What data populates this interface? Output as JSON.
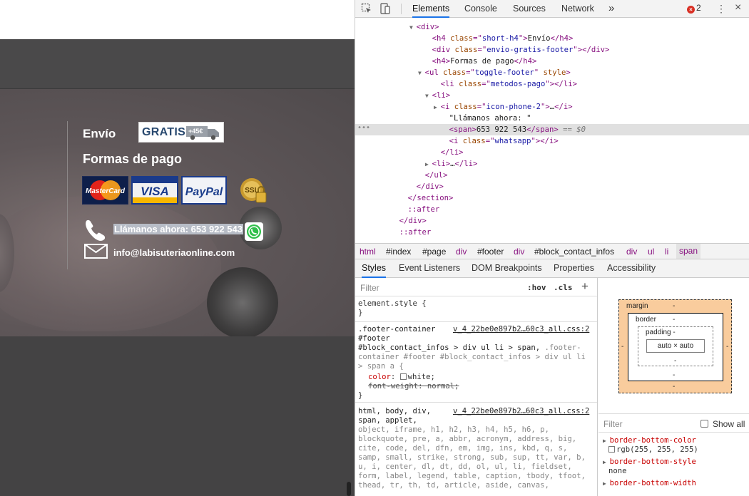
{
  "site": {
    "footer": {
      "envio_heading": "Envío",
      "gratis_badge": "GRATIS",
      "gratis_amount": "+45€",
      "formas_heading": "Formas de pago",
      "payment_methods": [
        "MasterCard",
        "VISA",
        "PayPal",
        "SSL"
      ],
      "phone_text": "Llámanos ahora: 653 922 543",
      "email": "info@labisuteriaonline.com"
    }
  },
  "devtools": {
    "tabs": [
      "Elements",
      "Console",
      "Sources",
      "Network"
    ],
    "more_tabs": "»",
    "error_count": "2",
    "error_mark": "×",
    "tree": [
      {
        "tri": "▼",
        "html": "<span class='tag'>&lt;div&gt;</span>"
      },
      {
        "tri": "",
        "html": "<span class='tag'>&lt;h4</span> <span class='an'>class</span><span class='tag'>=\"</span><span class='av'>short-h4</span><span class='tag'>\"&gt;</span><span class='tx'>Envío</span><span class='tag'>&lt;/h4&gt;</span>"
      },
      {
        "tri": "",
        "html": "<span class='tag'>&lt;div</span> <span class='an'>class</span><span class='tag'>=\"</span><span class='av'>envio-gratis-footer</span><span class='tag'>\"&gt;&lt;/div&gt;</span>"
      },
      {
        "tri": "",
        "html": "<span class='tag'>&lt;h4&gt;</span><span class='tx'>Formas de pago</span><span class='tag'>&lt;/h4&gt;</span>"
      },
      {
        "tri": "▼",
        "html": "<span class='tag'>&lt;ul</span> <span class='an'>class</span><span class='tag'>=\"</span><span class='av'>toggle-footer</span><span class='tag'>\"</span> <span class='an'>style</span><span class='tag'>&gt;</span>"
      },
      {
        "tri": "",
        "html": "<span class='tag'>&lt;li</span> <span class='an'>class</span><span class='tag'>=\"</span><span class='av'>metodos-pago</span><span class='tag'>\"&gt;&lt;/li&gt;</span>"
      },
      {
        "tri": "▼",
        "html": "<span class='tag'>&lt;li&gt;</span>"
      },
      {
        "tri": "▶",
        "html": "<span class='tag'>&lt;i</span> <span class='an'>class</span><span class='tag'>=\"</span><span class='av'>icon-phone-2</span><span class='tag'>\"&gt;</span><span class='tx'>…</span><span class='tag'>&lt;/i&gt;</span>"
      },
      {
        "tri": "",
        "html": "<span class='tx'>\"Llámanos ahora: \"</span>"
      },
      {
        "tri": "",
        "html": "<span class='tag'>&lt;span&gt;</span><span class='tx'>653 922 543</span><span class='tag'>&lt;/span&gt;</span> <span class='eq'>== $0</span>"
      },
      {
        "tri": "",
        "html": "<span class='tag'>&lt;i</span> <span class='an'>class</span><span class='tag'>=\"</span><span class='av'>whatsapp</span><span class='tag'>\"&gt;&lt;/i&gt;</span>"
      },
      {
        "tri": "",
        "html": "<span class='tag'>&lt;/li&gt;</span>"
      },
      {
        "tri": "▶",
        "html": "<span class='tag'>&lt;li&gt;</span><span class='tx'>…</span><span class='tag'>&lt;/li&gt;</span>"
      },
      {
        "tri": "",
        "html": "<span class='tag'>&lt;/ul&gt;</span>"
      },
      {
        "tri": "",
        "html": "<span class='tag'>&lt;/div&gt;</span>"
      },
      {
        "tri": "",
        "html": "<span class='tag'>&lt;/section&gt;</span>"
      },
      {
        "tri": "",
        "html": "<span class='tag'>::after</span>"
      },
      {
        "tri": "",
        "html": "<span class='tag'>&lt;/div&gt;</span>"
      },
      {
        "tri": "",
        "html": "<span class='tag'>::after</span>"
      }
    ],
    "breadcrumbs": [
      "html",
      "#index",
      "#page",
      "div",
      "#footer",
      "div",
      "#block_contact_infos",
      "div",
      "ul",
      "li",
      "span"
    ],
    "sub_tabs": [
      "Styles",
      "Event Listeners",
      "DOM Breakpoints",
      "Properties",
      "Accessibility"
    ],
    "styles": {
      "filter_placeholder": "Filter",
      "hov": ":hov",
      "cls": ".cls",
      "plus": "+",
      "element_style": "element.style {",
      "close_brace": "}",
      "rule1_source": "v_4_22be0e897b2…60c3_all.css:2",
      "rule1_sel1": ".footer-container",
      "rule1_sel2": "#footer",
      "rule1_sel3": "#block_contact_infos > div ul li > span,",
      "rule1_sel3b": " .footer-",
      "rule1_sel4": "container #footer #block_contact_infos > div ul li",
      "rule1_sel5": "> span a {",
      "rule1_prop1": "color",
      "rule1_val1": "white;",
      "rule1_prop2": "font-weight: normal;",
      "rule2_source": "v_4_22be0e897b2…60c3_all.css:2",
      "rule2_lines": [
        "html, body, div,",
        "span, applet,",
        "object, iframe, h1, h2, h3, h4, h5, h6, p,",
        "blockquote, pre, a, abbr, acronym, address, big,",
        "cite, code, del, dfn, em, img, ins, kbd, q, s,",
        "samp, small, strike, strong, sub, sup, tt, var, b,",
        "u, i, center, dl, dt, dd, ol, ul, li, fieldset,",
        "form, label, legend, table, caption, tbody, tfoot,",
        "thead, tr, th, td, article, aside, canvas,"
      ]
    },
    "box_model": {
      "margin": "margin",
      "border": "border",
      "padding": "padding -",
      "content": "auto × auto",
      "dash": "-"
    },
    "computed": {
      "filter_placeholder": "Filter",
      "show_all": "Show all",
      "props": [
        {
          "name": "border-bottom-color",
          "value": "rgb(255, 255, 255)",
          "swatch": true
        },
        {
          "name": "border-bottom-style",
          "value": "none",
          "swatch": false
        },
        {
          "name": "border-bottom-width",
          "value": "",
          "swatch": false
        }
      ]
    }
  },
  "colors": {
    "accent": "#1a73e8",
    "site_bg": "#444344",
    "tag": "#881280",
    "error": "#d93025"
  }
}
